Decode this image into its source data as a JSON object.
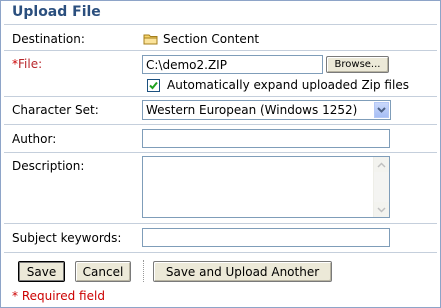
{
  "form": {
    "title": "Upload File",
    "destination": {
      "label": "Destination:",
      "value": "Section Content"
    },
    "file": {
      "required_mark": "*",
      "label": "File:",
      "value": "C:\\demo2.ZIP",
      "browse_label": "Browse...",
      "auto_expand_label": "Automatically expand uploaded Zip files",
      "auto_expand_checked": true
    },
    "charset": {
      "label": "Character Set:",
      "selected": "Western European (Windows 1252)"
    },
    "author": {
      "label": "Author:",
      "value": ""
    },
    "description": {
      "label": "Description:",
      "value": ""
    },
    "keywords": {
      "label": "Subject keywords:",
      "value": ""
    }
  },
  "actions": {
    "save_label": "Save",
    "cancel_label": "Cancel",
    "save_another_label": "Save and Upload Another"
  },
  "footer": {
    "required_note": "* Required field"
  },
  "colors": {
    "title": "#2b4f7e",
    "required": "#cc0000",
    "border": "#8ea4c8"
  }
}
